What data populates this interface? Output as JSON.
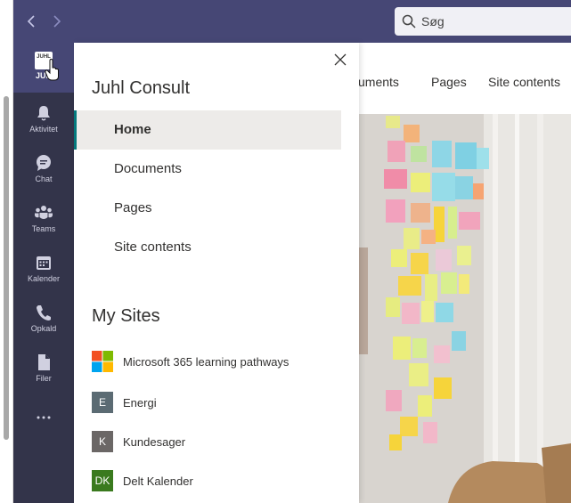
{
  "topbar": {
    "search_placeholder": "Søg"
  },
  "rail": {
    "items": [
      {
        "label": "JUH",
        "icon": "juhl-logo"
      },
      {
        "label": "Aktivitet",
        "icon": "bell-icon"
      },
      {
        "label": "Chat",
        "icon": "chat-icon"
      },
      {
        "label": "Teams",
        "icon": "teams-icon"
      },
      {
        "label": "Kalender",
        "icon": "calendar-icon"
      },
      {
        "label": "Opkald",
        "icon": "phone-icon"
      },
      {
        "label": "Filer",
        "icon": "file-icon"
      },
      {
        "label": "...",
        "icon": "more-icon"
      }
    ],
    "logo_text": "JUHL"
  },
  "site_header": {
    "nav": [
      "cuments",
      "Pages",
      "Site contents"
    ]
  },
  "panel": {
    "title": "Juhl Consult",
    "nav": [
      {
        "label": "Home",
        "selected": true
      },
      {
        "label": "Documents",
        "selected": false
      },
      {
        "label": "Pages",
        "selected": false
      },
      {
        "label": "Site contents",
        "selected": false
      }
    ],
    "my_sites_title": "My Sites",
    "sites": [
      {
        "name": "Microsoft 365 learning pathways",
        "initials": "",
        "color": "ms-logo"
      },
      {
        "name": "Energi",
        "initials": "E",
        "color": "#5b6b73"
      },
      {
        "name": "Kundesager",
        "initials": "K",
        "color": "#6b6766"
      },
      {
        "name": "Delt Kalender",
        "initials": "DK",
        "color": "#3a7a1e"
      }
    ]
  },
  "colors": {
    "topbar": "#464775",
    "rail": "#33344a",
    "accent": "#03787c"
  }
}
